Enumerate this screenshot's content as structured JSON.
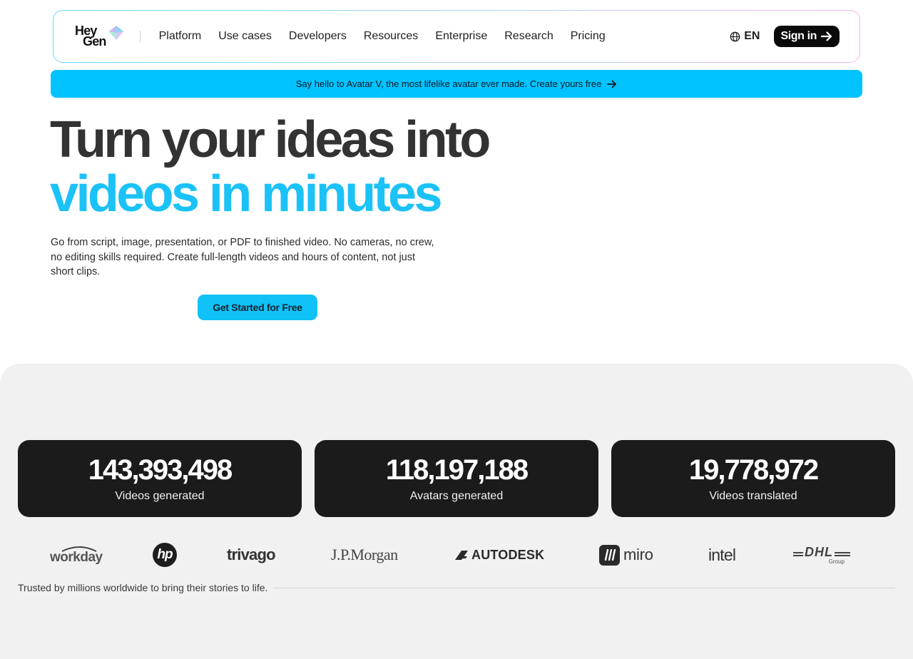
{
  "nav": {
    "logo_line1": "Hey",
    "logo_line2": "Gen",
    "links": [
      "Platform",
      "Use cases",
      "Developers",
      "Resources",
      "Enterprise",
      "Research",
      "Pricing"
    ],
    "language": "EN",
    "signin_label": "Sign in"
  },
  "banner": {
    "text": "Say hello to Avatar V, the most lifelike avatar ever made. Create yours free"
  },
  "hero": {
    "title_line1": "Turn your ideas into",
    "title_line2": "videos in minutes",
    "subtitle": "Go from script, image, presentation, or PDF to finished video. No cameras, no crew, no editing skills required. Create full-length videos and hours of content, not just short clips.",
    "cta_label": "Get Started for Free"
  },
  "stats": [
    {
      "value": "143,393,498",
      "label": "Videos generated"
    },
    {
      "value": "118,197,188",
      "label": "Avatars generated"
    },
    {
      "value": "19,778,972",
      "label": "Videos translated"
    }
  ],
  "brands": {
    "workday": "workday",
    "hp": "hp",
    "trivago": "trivago",
    "jpmorgan": "J.P.Morgan",
    "autodesk": "AUTODESK",
    "miro": "miro",
    "intel": "intel",
    "dhl": "DHL",
    "dhl_group": "Group"
  },
  "trusted_text": "Trusted by millions worldwide to bring their stories to life.",
  "colors": {
    "accent": "#00c3ff",
    "hero_blue": "#1bc2f7",
    "dark": "#1b1b1b",
    "section_bg": "#f1f1f1"
  }
}
